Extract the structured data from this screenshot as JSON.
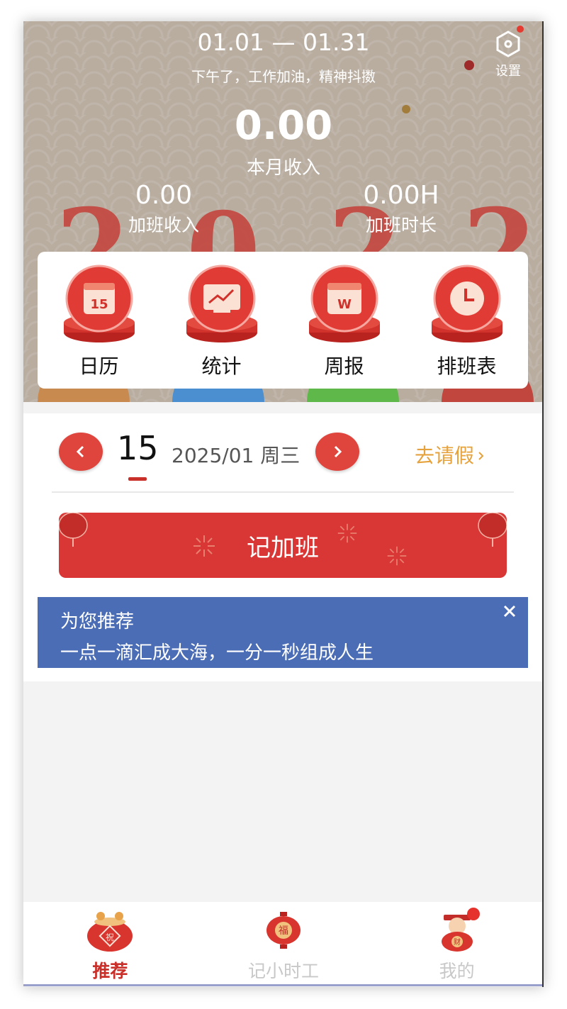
{
  "header": {
    "period": "01.01 — 01.31",
    "greeting": "下午了，工作加油，精神抖擞",
    "settings_label": "设置",
    "monthly_income_value": "0.00",
    "monthly_income_label": "本月收入",
    "overtime_income_value": "0.00",
    "overtime_income_label": "加班收入",
    "overtime_hours_value": "0.00H",
    "overtime_hours_label": "加班时长"
  },
  "quick_actions": [
    {
      "label": "日历",
      "icon": "calendar-icon",
      "glyph": "15"
    },
    {
      "label": "统计",
      "icon": "chart-icon"
    },
    {
      "label": "周报",
      "icon": "weekly-report-icon",
      "glyph": "W"
    },
    {
      "label": "排班表",
      "icon": "clock-icon"
    }
  ],
  "record": {
    "day": "15",
    "date_text": "2025/01 周三",
    "leave_link": "去请假",
    "overtime_button": "记加班"
  },
  "recommend": {
    "title": "为您推荐",
    "text": "一点一滴汇成大海，一分一秒组成人生"
  },
  "bottom_nav": [
    {
      "label": "推荐",
      "icon": "blessing-pot-icon",
      "glyph": "祝",
      "active": true
    },
    {
      "label": "记小时工",
      "icon": "lantern-icon",
      "glyph": "福",
      "active": false
    },
    {
      "label": "我的",
      "icon": "fortune-god-icon",
      "glyph": "财",
      "active": false
    }
  ],
  "colors": {
    "accent_red": "#d93636",
    "leave_orange": "#e6a23c",
    "recommend_blue": "#4b6db5",
    "header_bg": "#b9ada0"
  }
}
